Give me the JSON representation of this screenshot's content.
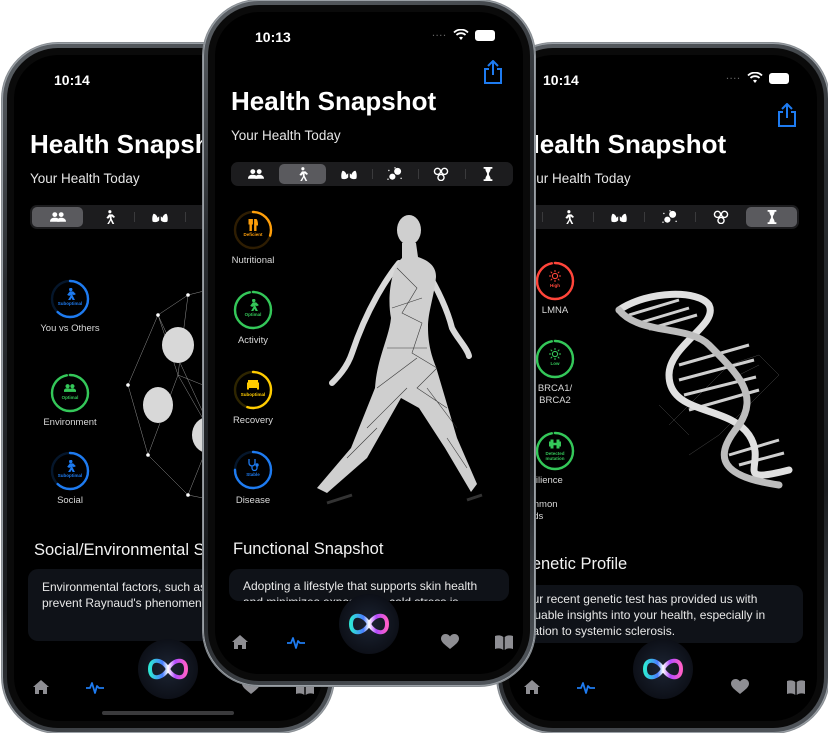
{
  "colors": {
    "accent_blue": "#1e7bf0",
    "optimal_green": "#34c759",
    "deficient_orange": "#ff9f0a",
    "suboptimal_yellow": "#ffcc00",
    "high_red": "#ff453a",
    "card_bg": "#0f1218"
  },
  "common": {
    "app_title": "Health Snapshot",
    "subtitle": "Your Health Today",
    "segments": [
      {
        "icon": "people-icon",
        "name": "social"
      },
      {
        "icon": "walking-figure-icon",
        "name": "functional"
      },
      {
        "icon": "lungs-icon",
        "name": "organ"
      },
      {
        "icon": "particles-icon",
        "name": "cellular"
      },
      {
        "icon": "molecule-icon",
        "name": "molecular"
      },
      {
        "icon": "hourglass-icon",
        "name": "genetic"
      }
    ],
    "tabbar": [
      {
        "icon": "house-icon",
        "name": "home"
      },
      {
        "icon": "heartbeat-icon",
        "name": "health",
        "active": true
      },
      {
        "icon": "infinity-orb-icon",
        "name": "assistant"
      },
      {
        "icon": "heart-icon",
        "name": "favorites"
      },
      {
        "icon": "book-icon",
        "name": "library"
      }
    ]
  },
  "phones": {
    "left": {
      "time": "10:14",
      "selected_segment": "social",
      "metrics": [
        {
          "label": "You vs Others",
          "status": "Suboptimal",
          "icon": "walking-figure-icon",
          "color": "#1e7bf0",
          "progress": 0.62
        },
        {
          "label": "Environment",
          "status": "Optimal",
          "icon": "people-icon",
          "color": "#34c759",
          "progress": 0.97
        },
        {
          "label": "Social",
          "status": "Suboptimal",
          "icon": "walking-figure-icon",
          "color": "#1e7bf0",
          "progress": 0.62
        }
      ],
      "section_title": "Social/Environmental Snapshot",
      "card_text": "Environmental factors, such as avoiding extreme cold to prevent Raynaud's phenomenon flare-ups, are vital"
    },
    "center": {
      "time": "10:13",
      "selected_segment": "functional",
      "metrics": [
        {
          "label": "Nutritional",
          "status": "Deficient",
          "icon": "fork-knife-icon",
          "color": "#ff9f0a",
          "progress": 0.3
        },
        {
          "label": "Activity",
          "status": "Optimal",
          "icon": "walking-figure-icon",
          "color": "#34c759",
          "progress": 0.97
        },
        {
          "label": "Recovery",
          "status": "Suboptimal",
          "icon": "bed-icon",
          "color": "#ffcc00",
          "progress": 0.55
        },
        {
          "label": "Disease",
          "status": "Stable",
          "icon": "stethoscope-icon",
          "color": "#1e7bf0",
          "progress": 0.75
        }
      ],
      "section_title": "Functional Snapshot",
      "card_text": "Adopting a lifestyle that supports skin health and minimizes exposure to cold stress is important"
    },
    "right": {
      "time": "10:14",
      "selected_segment": "genetic",
      "metrics": [
        {
          "label": "LMNA",
          "status": "High",
          "icon": "sun-icon",
          "color": "#ff453a",
          "progress": 0.97
        },
        {
          "label": "BRCA1/ BRCA2",
          "status": "Low",
          "icon": "sun-icon",
          "color": "#34c759",
          "progress": 0.97
        },
        {
          "label": "Resilience to Common Colds",
          "status": "Detected mutation",
          "icon": "dumbbell-icon",
          "color": "#34c759",
          "progress": 0.97
        }
      ],
      "section_title": "Genetic Profile",
      "card_text": "Your recent genetic test has provided us with valuable insights into your health, especially in relation to systemic sclerosis."
    }
  }
}
